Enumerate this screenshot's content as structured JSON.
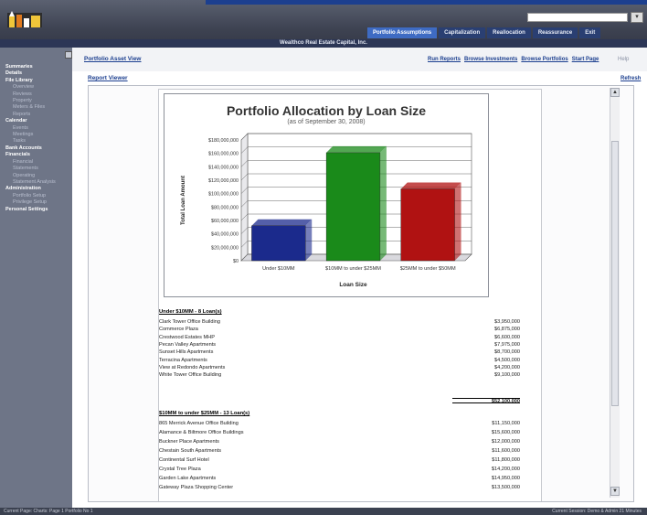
{
  "search": {
    "placeholder": "",
    "go_label": ""
  },
  "tabs": [
    {
      "label": "Portfolio Assumptions",
      "active": true
    },
    {
      "label": "Capitalization",
      "active": false
    },
    {
      "label": "Reallocation",
      "active": false
    },
    {
      "label": "Reassurance",
      "active": false
    },
    {
      "label": "Exit",
      "active": false
    }
  ],
  "subtitle_bar": "Wealthco Real Estate Capital, Inc.",
  "nav": [
    {
      "label": "Summaries",
      "kind": "section"
    },
    {
      "label": "Details",
      "kind": "section"
    },
    {
      "label": "File Library",
      "kind": "section"
    },
    {
      "label": "Overview",
      "kind": "sub"
    },
    {
      "label": "Reviews",
      "kind": "sub"
    },
    {
      "label": "Property",
      "kind": "sub"
    },
    {
      "label": "Meters & Files",
      "kind": "sub"
    },
    {
      "label": "Reports",
      "kind": "sub"
    },
    {
      "label": "Calendar",
      "kind": "section"
    },
    {
      "label": "Events",
      "kind": "sub"
    },
    {
      "label": "Meetings",
      "kind": "sub"
    },
    {
      "label": "Tasks",
      "kind": "sub"
    },
    {
      "label": "Bank Accounts",
      "kind": "section"
    },
    {
      "label": "Financials",
      "kind": "section"
    },
    {
      "label": "Financial",
      "kind": "sub"
    },
    {
      "label": "Statements",
      "kind": "sub"
    },
    {
      "label": "Operating",
      "kind": "sub"
    },
    {
      "label": "Statement Analysis",
      "kind": "sub"
    },
    {
      "label": "Administration",
      "kind": "section"
    },
    {
      "label": "Portfolio Setup",
      "kind": "sub"
    },
    {
      "label": "Privilege Setup",
      "kind": "sub"
    },
    {
      "label": "Personal Settings",
      "kind": "section"
    }
  ],
  "header": {
    "title": "Portfolio Asset View",
    "links": [
      "Run Reports",
      "Browse Investments",
      "Browse Portfolios",
      "Start Page"
    ],
    "help": "Help",
    "report_viewer": "Report Viewer",
    "refresh": "Refresh"
  },
  "colors": {
    "bar_under10": "#1b2a8c",
    "bar_10to25": "#1a8a1a",
    "bar_25to50": "#b01212",
    "accent": "#1c3f8f"
  },
  "chart_data": {
    "type": "bar",
    "title": "Portfolio Allocation by Loan Size",
    "subtitle": "(as of September 30, 2008)",
    "xlabel": "Loan Size",
    "ylabel": "Total Loan Amount",
    "categories": [
      "Under $10MM",
      "$10MM to under $25MM",
      "$25MM to under $50MM"
    ],
    "values": [
      52100000,
      161000000,
      107000000
    ],
    "yticks": [
      "$0",
      "$20,000,000",
      "$40,000,000",
      "$60,000,000",
      "$80,000,000",
      "$100,000,000",
      "$120,000,000",
      "$140,000,000",
      "$160,000,000",
      "$180,000,000"
    ],
    "ylim": [
      0,
      180000000
    ],
    "grid": true
  },
  "groups": [
    {
      "title": "Under $10MM - 8 Loan(s)",
      "rows": [
        {
          "name": "Clark Tower Office Building",
          "value": "$3,950,000"
        },
        {
          "name": "Commerce Plaza",
          "value": "$6,875,000"
        },
        {
          "name": "Crestwood Estates MHP",
          "value": "$6,600,000"
        },
        {
          "name": "Pecan Valley Apartments",
          "value": "$7,975,000"
        },
        {
          "name": "Sunset Hills Apartments",
          "value": "$8,700,000"
        },
        {
          "name": "Terracina Apartments",
          "value": "$4,500,000"
        },
        {
          "name": "View at Redondo Apartments",
          "value": "$4,200,000"
        },
        {
          "name": "White Tower Office Building",
          "value": "$9,100,000"
        }
      ],
      "total": "$52,100,000"
    },
    {
      "title": "$10MM to under $25MM - 13 Loan(s)",
      "rows": [
        {
          "name": "865 Merrick Avenue Office Building",
          "value": "$11,150,000"
        },
        {
          "name": "Alamance & Biltmore Office Buildings",
          "value": "$15,600,000"
        },
        {
          "name": "Buckner Place Apartments",
          "value": "$12,000,000"
        },
        {
          "name": "Chestain South Apartments",
          "value": "$11,600,000"
        },
        {
          "name": "Continental Surf Hotel",
          "value": "$11,800,000"
        },
        {
          "name": "Crystal Tree Plaza",
          "value": "$14,200,000"
        },
        {
          "name": "Garden Lake Apartments",
          "value": "$14,950,000"
        },
        {
          "name": "Gateway Plaza Shopping Center",
          "value": "$13,500,000"
        }
      ]
    }
  ],
  "status": {
    "left": "Current Page: Charts: Page 1 Portfolio No 1",
    "right": "Current Session: Demo & Admin 21 Minutes"
  }
}
